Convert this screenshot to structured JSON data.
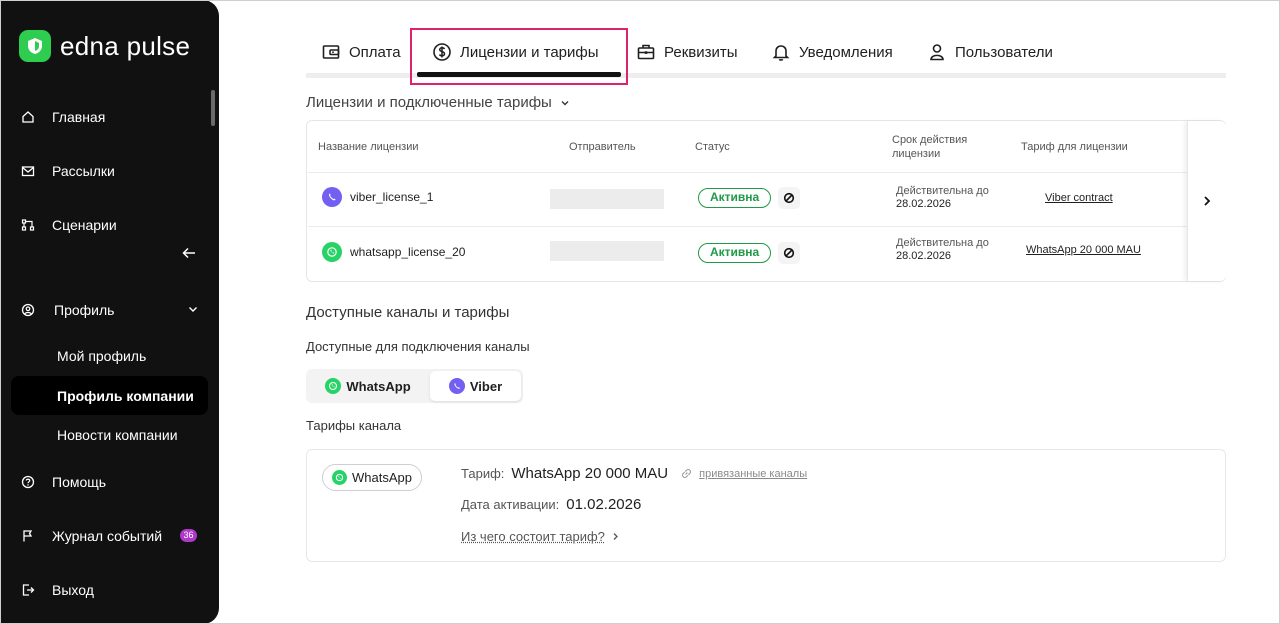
{
  "brand": {
    "name": "edna pulse",
    "color": "#2ecc4f"
  },
  "sidebar": {
    "items": [
      {
        "label": "Главная",
        "icon": "home-icon"
      },
      {
        "label": "Рассылки",
        "icon": "mail-icon"
      },
      {
        "label": "Сценарии",
        "icon": "flow-icon"
      },
      {
        "label": "Профиль",
        "icon": "user-circle-icon"
      },
      {
        "label": "Помощь",
        "icon": "help-icon"
      },
      {
        "label": "Журнал событий",
        "icon": "flag-icon",
        "badge": "36"
      },
      {
        "label": "Выход",
        "icon": "logout-icon"
      }
    ],
    "profile_sub": [
      {
        "label": "Мой профиль"
      },
      {
        "label": "Профиль компании",
        "active": true
      },
      {
        "label": "Новости компании"
      }
    ]
  },
  "tabs": [
    {
      "label": "Оплата",
      "icon": "wallet-icon"
    },
    {
      "label": "Лицензии и тарифы",
      "icon": "dollar-circle-icon",
      "active": true
    },
    {
      "label": "Реквизиты",
      "icon": "briefcase-icon"
    },
    {
      "label": "Уведомления",
      "icon": "bell-icon"
    },
    {
      "label": "Пользователи",
      "icon": "user-icon"
    }
  ],
  "licenses": {
    "title": "Лицензии и подключенные тарифы",
    "columns": {
      "name": "Название лицензии",
      "sender": "Отправитель",
      "status": "Статус",
      "valid_line1": "Срок действия",
      "valid_line2": "лицензии",
      "tariff": "Тариф для лицензии"
    },
    "rows": [
      {
        "name": "viber_license_1",
        "channel": "viber",
        "status": "Активна",
        "valid_label": "Действительна до",
        "valid_date": "28.02.2026",
        "tariff": "Viber contract"
      },
      {
        "name": "whatsapp_license_20",
        "channel": "whatsapp",
        "status": "Активна",
        "valid_label": "Действительна до",
        "valid_date": "28.02.2026",
        "tariff": "WhatsApp 20 000 MAU"
      }
    ]
  },
  "available": {
    "title": "Доступные каналы и тарифы",
    "channels_label": "Доступные для подключения каналы",
    "channels": [
      {
        "label": "WhatsApp",
        "selected": false
      },
      {
        "label": "Viber",
        "selected": true
      }
    ],
    "tariffs_label": "Тарифы канала",
    "tariff_card": {
      "channel": "WhatsApp",
      "tariff_key": "Тариф:",
      "tariff_value": "WhatsApp 20 000 MAU",
      "linked_label": "привязанные каналы",
      "activation_key": "Дата активации:",
      "activation_value": "01.02.2026",
      "details_link": "Из чего состоит тариф?"
    }
  },
  "colors": {
    "active_status": "#1f9a46",
    "highlight": "#e0226e",
    "viber": "#7360f2",
    "whatsapp": "#25d366",
    "badge": "#b038c9"
  }
}
